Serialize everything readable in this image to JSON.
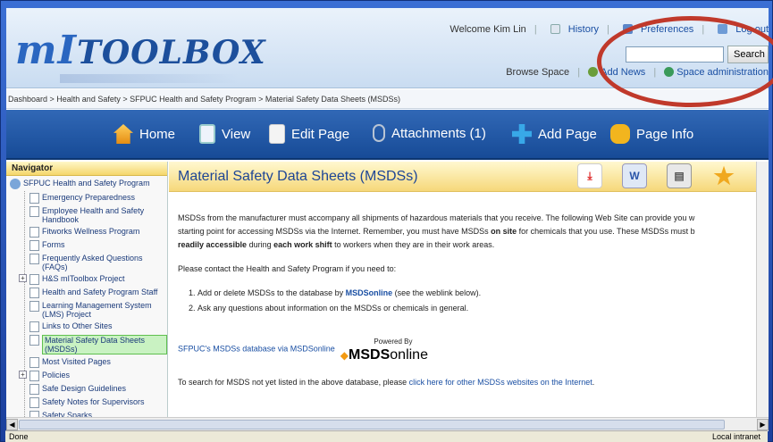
{
  "header": {
    "logo_text": "TOOLBOX",
    "logo_prefix": "mI",
    "welcome": "Welcome Kim Lin",
    "history": "History",
    "preferences": "Preferences",
    "logout": "Log out",
    "search_button": "Search",
    "search_placeholder": "",
    "browse_space": "Browse Space",
    "mail_news": "Add News",
    "space_admin": "Space administration"
  },
  "breadcrumb": "Dashboard > Health and Safety > SFPUC Health and Safety Program > Material Safety Data Sheets (MSDSs)",
  "navbar": [
    {
      "label": "Home"
    },
    {
      "label": "View"
    },
    {
      "label": "Edit Page"
    },
    {
      "label": "Attachments (1)"
    },
    {
      "label": "Add Page"
    },
    {
      "label": "Page Info"
    }
  ],
  "sidebar": {
    "title": "Navigator",
    "root": "SFPUC Health and Safety Program",
    "items": [
      {
        "label": "Emergency Preparedness",
        "expandable": false
      },
      {
        "label": "Employee Health and Safety Handbook",
        "expandable": false
      },
      {
        "label": "Fitworks Wellness Program",
        "expandable": false
      },
      {
        "label": "Forms",
        "expandable": false
      },
      {
        "label": "Frequently Asked Questions (FAQs)",
        "expandable": false
      },
      {
        "label": "H&S mIToolbox Project",
        "expandable": true
      },
      {
        "label": "Health and Safety Program Staff",
        "expandable": false
      },
      {
        "label": "Learning Management System (LMS) Project",
        "expandable": false
      },
      {
        "label": "Links to Other Sites",
        "expandable": false
      },
      {
        "label": "Material Safety Data Sheets (MSDSs)",
        "expandable": false,
        "selected": true
      },
      {
        "label": "Most Visited Pages",
        "expandable": false
      },
      {
        "label": "Policies",
        "expandable": true
      },
      {
        "label": "Safe Design Guidelines",
        "expandable": false
      },
      {
        "label": "Safety Notes for Supervisors",
        "expandable": false
      },
      {
        "label": "Safety Sparks",
        "expandable": false
      }
    ]
  },
  "content": {
    "title": "Material Safety Data Sheets (MSDSs)",
    "para1_a": "MSDSs from the manufacturer must accompany all shipments of hazardous materials that you receive. The following Web Site can provide you w",
    "para1_b": "starting point for accessing MSDSs via the Internet. Remember, you must have MSDSs ",
    "para1_bold1": "on site",
    "para1_c": " for chemicals that you use. These MSDSs must b",
    "para1_bold2": "readily accessible",
    "para1_d": " during ",
    "para1_bold3": "each work shift",
    "para1_e": " to workers when they are in their work areas.",
    "para2": "Please contact the Health and Safety Program if you need to:",
    "list1_a": "Add or delete MSDSs to the database by ",
    "list1_link": "MSDSonline",
    "list1_b": " (see the weblink below).",
    "list2": "Ask any questions about information on the MSDSs or chemicals in general.",
    "msds_link": "SFPUC's MSDSs database via MSDSonline",
    "powered_by": "Powered By",
    "msds_logo_bold": "MSDS",
    "msds_logo_rest": "online",
    "para3_a": "To search for MSDS not yet listed in the above database, please ",
    "para3_link": "click here for other MSDSs websites on the Internet",
    "para3_b": "."
  },
  "status": {
    "left": "Done",
    "right": "Local intranet"
  },
  "colors": {
    "navbar": "#1f56a6",
    "title_bg": "#f6d87a",
    "highlight_oval": "#c0392b",
    "selected_item": "#c9f2c2"
  }
}
